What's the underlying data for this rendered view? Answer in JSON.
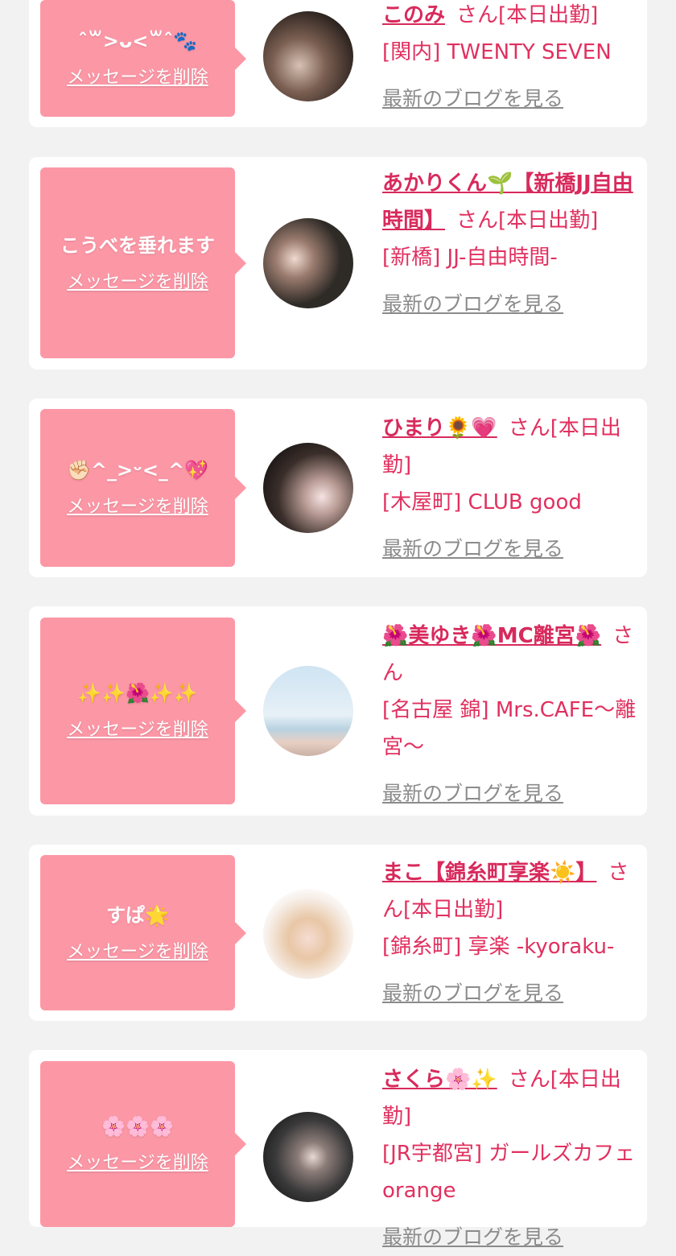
{
  "cards": [
    {
      "message": "ˆ꒳>ᴗ<꒳ˆ🐾",
      "delete": "メッセージを削除",
      "name": "このみ",
      "san": "さん[本日出勤]",
      "shop": "[関内] TWENTY SEVEN",
      "blog": "最新のブログを見る"
    },
    {
      "message": "こうべを垂れます",
      "delete": "メッセージを削除",
      "name": "あかりくん🌱【新橋JJ自由時間】",
      "san": "さん[本日出勤]",
      "shop": "[新橋] JJ-自由時間-",
      "blog": "最新のブログを見る"
    },
    {
      "message": "✊🏻^_>ᵕ<_^💖",
      "delete": "メッセージを削除",
      "name": "ひまり🌻💗",
      "san": "さん[本日出勤]",
      "shop": "[木屋町] CLUB good",
      "blog": "最新のブログを見る"
    },
    {
      "message": "✨✨🌺✨✨",
      "delete": "メッセージを削除",
      "name": "🌺美ゆき🌺MC離宮🌺",
      "san": "さん",
      "shop": "[名古屋 錦] Mrs.CAFE〜離宮〜",
      "blog": "最新のブログを見る"
    },
    {
      "message": "すぱ🌟",
      "delete": "メッセージを削除",
      "name": "まこ【錦糸町享楽☀️】",
      "san": "さん[本日出勤]",
      "shop": "[錦糸町] 享楽 -kyoraku-",
      "blog": "最新のブログを見る"
    },
    {
      "message": "🌸🌸🌸",
      "delete": "メッセージを削除",
      "name": "さくら🌸✨",
      "san": "さん[本日出勤]",
      "shop": "[JR宇都宮] ガールズカフェ orange",
      "blog": "最新のブログを見る"
    }
  ],
  "colors": {
    "bubble": "#fc97a6",
    "name": "#d82a5c",
    "text": "#e1305f",
    "link": "#8b8b8b",
    "background": "#f2f2f2"
  }
}
